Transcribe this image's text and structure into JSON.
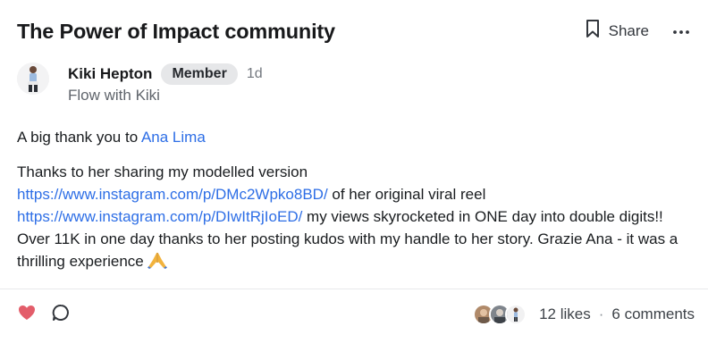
{
  "post": {
    "title": "The Power of Impact community",
    "share_label": "Share",
    "author": {
      "name": "Kiki Hepton",
      "badge": "Member",
      "time": "1d",
      "subtitle": "Flow with Kiki"
    },
    "body": {
      "thanks_prefix": "A big thank you to ",
      "mention": "Ana Lima",
      "p2_line1": "Thanks to her sharing my modelled version",
      "link1": "https://www.instagram.com/p/DMc2Wpko8BD/",
      "after_link1": " of her original viral reel",
      "link2": "https://www.instagram.com/p/DIwItRjIoED/",
      "after_link2": " my views skyrocketed in ONE day into double digits!! Over 11K in one day thanks to her posting kudos with my handle to her story. Grazie Ana - it was a thrilling experience",
      "emoji": "🙏"
    },
    "footer": {
      "likes": "12 likes",
      "separator": "·",
      "comments": "6 comments"
    }
  },
  "icons": {
    "bookmark": "bookmark-icon",
    "more": "more-dots-icon",
    "heart": "heart-icon",
    "comment": "comment-icon"
  },
  "colors": {
    "link": "#2d6ee6",
    "heart": "#e35d6a",
    "badge_bg": "#e6e7e9"
  }
}
